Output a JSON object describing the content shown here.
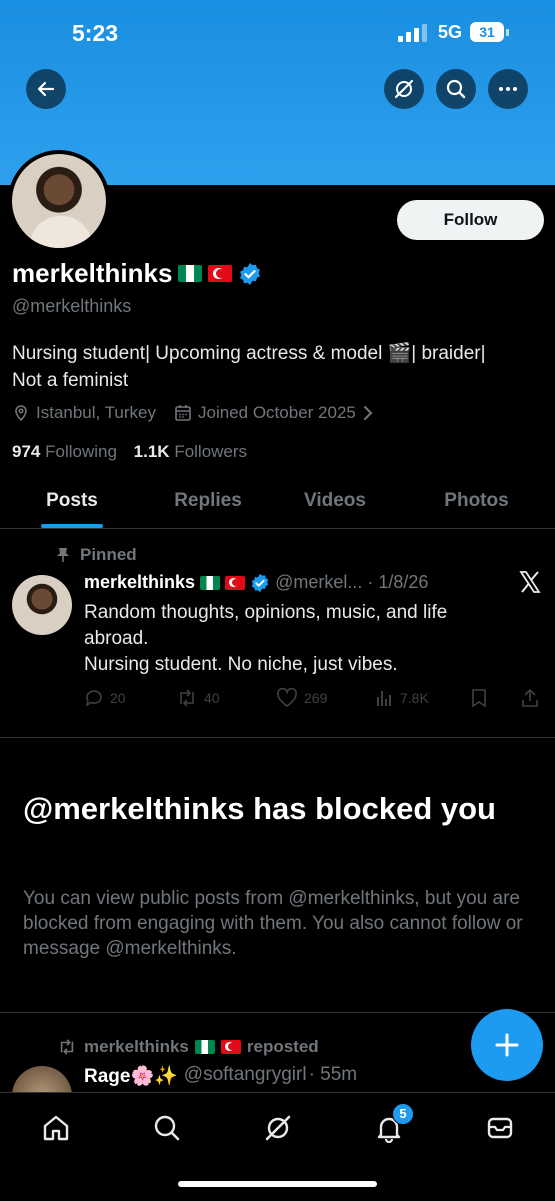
{
  "status_bar": {
    "time": "5:23",
    "network": "5G",
    "battery": "31"
  },
  "profile": {
    "display_name": "merkelthinks",
    "handle": "@merkelthinks",
    "bio_line1": "Nursing student| Upcoming actress & model 🎬| braider|",
    "bio_line2": "Not a feminist",
    "location": "Istanbul, Turkey",
    "joined": "Joined October 2025",
    "following_count": "974",
    "following_label": "Following",
    "followers_count": "1.1K",
    "followers_label": "Followers",
    "follow_button": "Follow"
  },
  "tabs": [
    {
      "label": "Posts"
    },
    {
      "label": "Replies"
    },
    {
      "label": "Videos"
    },
    {
      "label": "Photos"
    }
  ],
  "pinned_post": {
    "pinned_label": "Pinned",
    "author": "merkelthinks",
    "handle": "@merkel...",
    "date": "· 1/8/26",
    "text_line1": "Random thoughts, opinions, music, and life",
    "text_line2": "abroad.",
    "text_line3": "Nursing student. No niche, just vibes.",
    "replies": "20",
    "reposts": "40",
    "likes": "269",
    "views": "7.8K"
  },
  "blocked": {
    "title": "@merkelthinks has blocked you",
    "text": "You can view public posts from @merkelthinks, but you are blocked from engaging with them. You also cannot follow or message @merkelthinks."
  },
  "repost": {
    "author": "merkelthinks",
    "reposted_label": "reposted",
    "orig_name": "Rage🌸✨",
    "orig_handle": "@softangrygirl",
    "orig_time": "· 55m"
  },
  "nav": {
    "notifications_badge": "5"
  },
  "colors": {
    "accent": "#1d9bf0",
    "banner": "#1a8ee0",
    "muted": "#71767b"
  }
}
